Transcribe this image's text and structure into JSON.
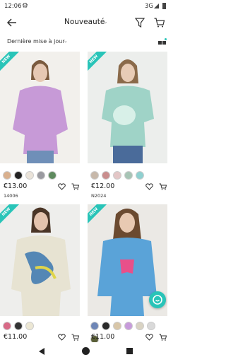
{
  "status_bar": {
    "time": "12:06",
    "network": "3G"
  },
  "header": {
    "title": "Nouveauté"
  },
  "sort": {
    "label": "Dernière mise à jour"
  },
  "products": [
    {
      "badge": "NEW",
      "price": "€13.00",
      "ref": "14006",
      "bg": "#f1efec",
      "swatches": [
        "#d9b08e",
        "#222",
        "#eae3d9",
        "#9a9aa0",
        "#5e8a5e"
      ]
    },
    {
      "badge": "NEW",
      "price": "€12.00",
      "ref": "N2024",
      "bg": "#eeefed",
      "swatches": [
        "#c7b8aa",
        "#c98d8d",
        "#e3c6c6",
        "#a7c4b5",
        "#8fd0d0"
      ]
    },
    {
      "badge": "NEW",
      "price": "€11.00",
      "ref": "",
      "bg": "#eeeeec",
      "swatches": [
        "#d86a87",
        "#333",
        "#ece7d4"
      ]
    },
    {
      "badge": "NEW",
      "price": "€11.00",
      "ref": "",
      "bg": "#eceae7",
      "swatches": [
        "#6e86b6",
        "#2a2a2a",
        "#d8c6a8",
        "#c79bdb",
        "#d9d3c3",
        "#d9d9d9",
        "#5a5f38"
      ]
    }
  ],
  "colors": {
    "accent": "#29c4b8"
  }
}
